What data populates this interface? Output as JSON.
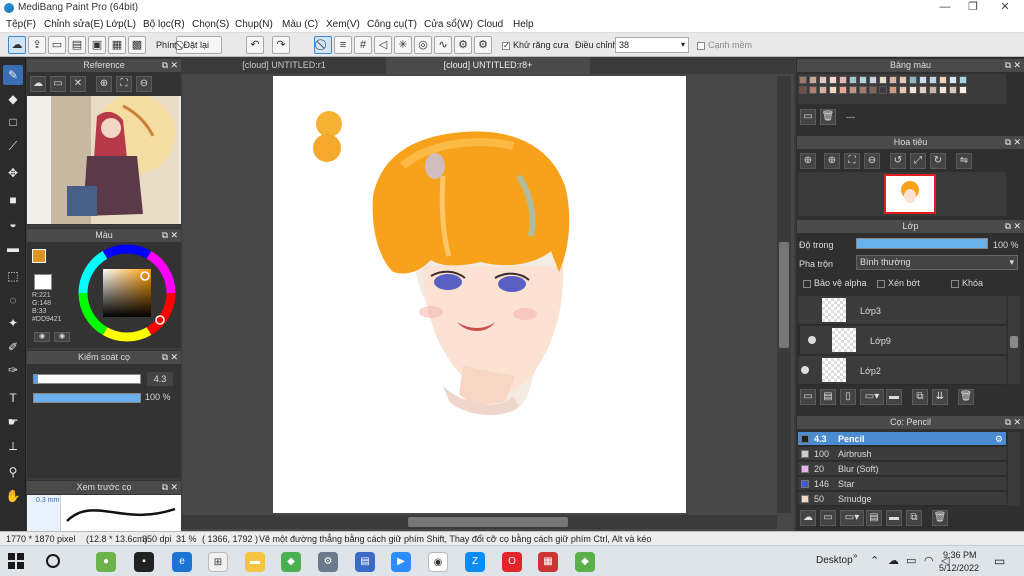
{
  "window": {
    "title": "MediBang Paint Pro (64bit)"
  },
  "menu": [
    "Tệp(F)",
    "Chỉnh sửa(E)",
    "Lớp(L)",
    "Bộ lọc(R)",
    "Chọn(S)",
    "Chụp(N)",
    "Màu (C)",
    "Xem(V)",
    "Công cụ(T)",
    "Cửa sổ(W)",
    "Cloud",
    "Help"
  ],
  "toolbar": {
    "phim_label": "Phím",
    "dat_lai_label": "Đặt lại",
    "antialias_label": "Khử răng cưa",
    "dieu_chinh_label": "Điều chỉnh",
    "dieu_chinh_value": "38",
    "canh_mem_label": "Cạnh mềm"
  },
  "reference_panel": {
    "title": "Reference"
  },
  "color_panel": {
    "title": "Màu",
    "r": "R:221",
    "g": "G:148",
    "b": "B:33",
    "hex": "#DD9421",
    "fg": "#dd9421"
  },
  "brush_control": {
    "title": "Kiểm soát cọ",
    "size": "4.3",
    "opacity": "100 %"
  },
  "brush_preview": {
    "title": "Xem trước cọ",
    "size_text": "0.3 mm"
  },
  "tabs": [
    "[cloud] UNTITLED:r1",
    "[cloud] UNTITLED:r8+"
  ],
  "palette_panel": {
    "title": "Bảng màu",
    "extra": "---"
  },
  "navigator_panel": {
    "title": "Hoa tiêu"
  },
  "layer_panel": {
    "title": "Lớp",
    "opacity_label": "Độ trong",
    "opacity_value": "100 %",
    "blend_label": "Pha trộn",
    "blend_value": "Bình thường",
    "protect_alpha": "Bảo vệ alpha",
    "clipping": "Xén bớt",
    "lock": "Khóa",
    "layers": [
      "Lớp3",
      "Lớp9",
      "Lớp2"
    ]
  },
  "brush_panel": {
    "title": "Cọ: Pencil",
    "brushes": [
      {
        "size": "4.3",
        "name": "Pencil",
        "color": "#222222"
      },
      {
        "size": "100",
        "name": "Airbrush",
        "color": "#cccccc"
      },
      {
        "size": "20",
        "name": "Blur (Soft)",
        "color": "#f3b0f3"
      },
      {
        "size": "146",
        "name": "Star",
        "color": "#3a5bd8"
      },
      {
        "size": "50",
        "name": "Smudge",
        "color": "#f4d9c4"
      }
    ]
  },
  "status": {
    "dims": "1770 * 1870 pixel",
    "size_cm": "(12.8 * 13.6cm)",
    "dpi": "350 dpi",
    "zoom": "31 %",
    "coords": "( 1366, 1792 )",
    "hint": "Vẽ một đường thẳng bằng cách giữ phím Shift, Thay đổi cỡ cọ bằng cách giữ phím Ctrl, Alt và kéo"
  },
  "taskbar": {
    "desktop_label": "Desktop",
    "time": "9:36 PM",
    "date": "5/12/2022"
  }
}
